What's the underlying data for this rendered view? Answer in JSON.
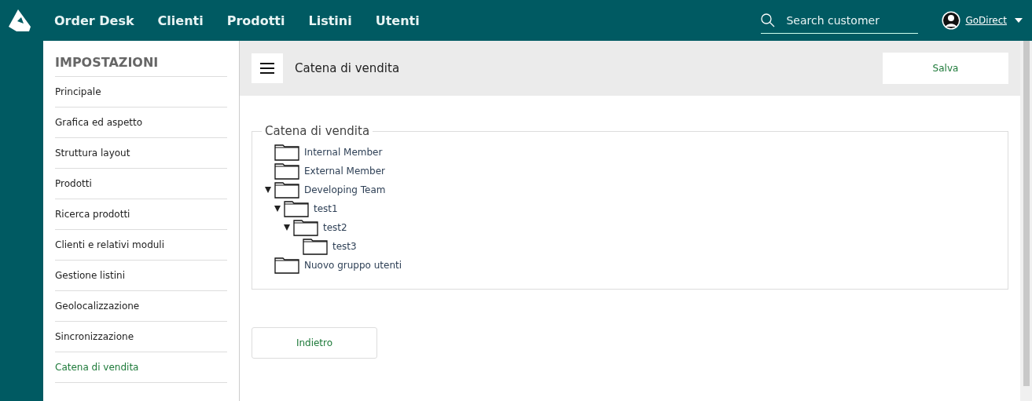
{
  "nav": {
    "items": [
      "Order Desk",
      "Clienti",
      "Prodotti",
      "Listini",
      "Utenti"
    ],
    "search": {
      "placeholder": "Search customer"
    },
    "user": "GoDirect"
  },
  "sidebar": {
    "title": "IMPOSTAZIONI",
    "items": [
      {
        "label": "Principale",
        "selected": false
      },
      {
        "label": "Grafica ed aspetto",
        "selected": false
      },
      {
        "label": "Struttura layout",
        "selected": false
      },
      {
        "label": "Prodotti",
        "selected": false
      },
      {
        "label": "Ricerca prodotti",
        "selected": false
      },
      {
        "label": "Clienti e relativi moduli",
        "selected": false
      },
      {
        "label": "Gestione listini",
        "selected": false
      },
      {
        "label": "Geolocalizzazione",
        "selected": false
      },
      {
        "label": "Sincronizzazione",
        "selected": false
      },
      {
        "label": "Catena di vendita",
        "selected": true
      }
    ]
  },
  "toolbar": {
    "title": "Catena di vendita",
    "save": "Salva"
  },
  "group": {
    "legend": "Catena di vendita",
    "tree": [
      {
        "label": "Internal Member",
        "expanded": false
      },
      {
        "label": "External Member",
        "expanded": false
      },
      {
        "label": "Developing Team",
        "expanded": true,
        "children": [
          {
            "label": "test1",
            "expanded": true,
            "children": [
              {
                "label": "test2",
                "expanded": true,
                "children": [
                  {
                    "label": "test3",
                    "expanded": false
                  }
                ]
              }
            ]
          }
        ]
      },
      {
        "label": "Nuovo gruppo utenti",
        "expanded": false
      }
    ]
  },
  "back": "Indietro"
}
